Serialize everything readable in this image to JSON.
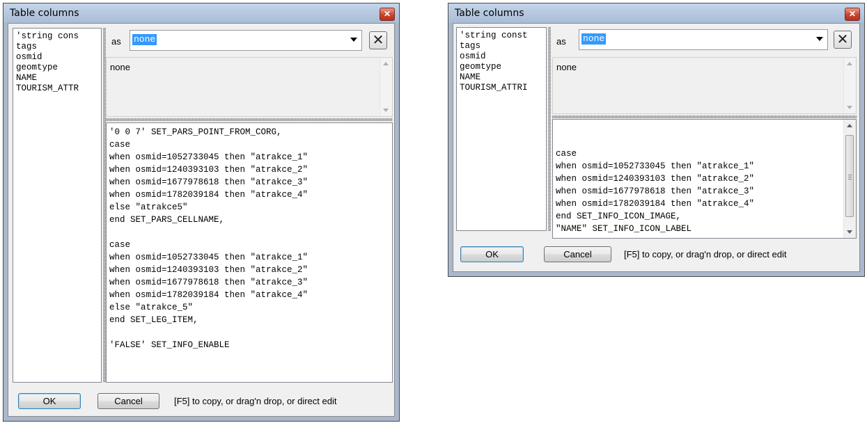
{
  "left_window": {
    "title": "Table columns",
    "columns": [
      "'string cons",
      "tags",
      "osmid",
      "geomtype",
      "NAME",
      "TOURISM_ATTR"
    ],
    "as_label": "as",
    "as_value": "none",
    "description": "none",
    "code_lines": [
      "'0 0 7' SET_PARS_POINT_FROM_CORG,",
      "case",
      "when osmid=1052733045 then \"atrakce_1\"",
      "when osmid=1240393103 then \"atrakce_2\"",
      "when osmid=1677978618 then \"atrakce_3\"",
      "when osmid=1782039184 then \"atrakce_4\"",
      "else \"atrakce5\"",
      "end SET_PARS_CELLNAME,",
      "",
      "case",
      "when osmid=1052733045 then \"atrakce_1\"",
      "when osmid=1240393103 then \"atrakce_2\"",
      "when osmid=1677978618 then \"atrakce_3\"",
      "when osmid=1782039184 then \"atrakce_4\"",
      "else \"atrakce_5\"",
      "end SET_LEG_ITEM,",
      "",
      "'FALSE' SET_INFO_ENABLE"
    ],
    "ok_label": "OK",
    "cancel_label": "Cancel",
    "hint": "[F5] to copy, or drag'n drop, or direct edit"
  },
  "right_window": {
    "title": "Table columns",
    "columns": [
      "'string const",
      "tags",
      "osmid",
      "geomtype",
      "NAME",
      "TOURISM_ATTRI"
    ],
    "as_label": "as",
    "as_value": "none",
    "description": "none",
    "code_lines": [
      "case",
      "when osmid=1052733045 then \"atrakce_1\"",
      "when osmid=1240393103 then \"atrakce_2\"",
      "when osmid=1677978618 then \"atrakce_3\"",
      "when osmid=1782039184 then \"atrakce_4\"",
      "end SET_INFO_ICON_IMAGE,",
      "\"NAME\" SET_INFO_ICON_LABEL"
    ],
    "ok_label": "OK",
    "cancel_label": "Cancel",
    "hint": "[F5] to copy, or drag'n drop, or direct edit"
  },
  "icons": {
    "close": "close-icon",
    "clear": "clear-icon",
    "dropdown": "chevron-down-icon"
  }
}
